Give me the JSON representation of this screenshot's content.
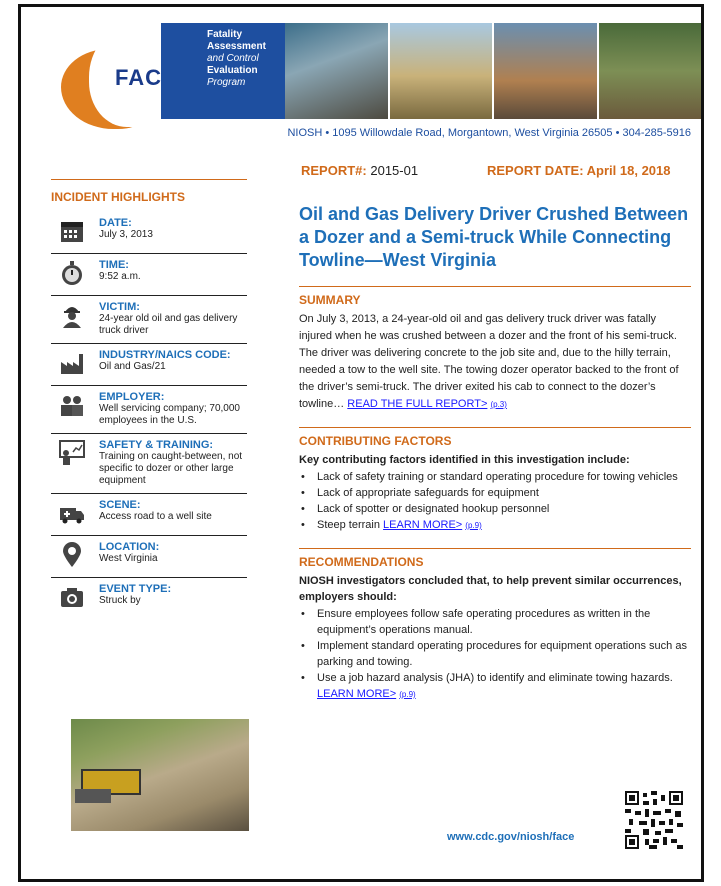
{
  "header": {
    "face_logo": "FACE",
    "program_lines": [
      "Fatality",
      "Assessment",
      "and Control",
      "Evaluation",
      "Program"
    ],
    "address": "NIOSH • 1095 Willowdale Road, Morgantown, West Virginia  26505 • 304-285-5916"
  },
  "report": {
    "number_label": "REPORT#:",
    "number": "2015-01",
    "date": "REPORT DATE: April 18, 2018"
  },
  "title": "Oil and Gas Delivery Driver Crushed Between a Dozer and a Semi-truck While Connecting Towline—West Virginia",
  "sidebar": {
    "heading": "INCIDENT HIGHLIGHTS",
    "items": [
      {
        "label": "DATE:",
        "value": "July 3, 2013",
        "icon": "calendar-icon"
      },
      {
        "label": "TIME:",
        "value": "9:52 a.m.",
        "icon": "stopwatch-icon"
      },
      {
        "label": "VICTIM:",
        "value": "24-year old oil and gas delivery truck driver",
        "icon": "worker-icon"
      },
      {
        "label": "INDUSTRY/NAICS CODE:",
        "value": "Oil and Gas/21",
        "icon": "factory-icon"
      },
      {
        "label": "EMPLOYER:",
        "value": "Well servicing company; 70,000 employees in the U.S.",
        "icon": "people-icon"
      },
      {
        "label": "SAFETY & TRAINING:",
        "value": "Training on caught-between, not specific to dozer or other large equipment",
        "icon": "trainer-icon"
      },
      {
        "label": "SCENE:",
        "value": "Access road to a well site",
        "icon": "ambulance-icon"
      },
      {
        "label": "LOCATION:",
        "value": "West Virginia",
        "icon": "location-pin-icon"
      },
      {
        "label": "EVENT TYPE:",
        "value": "Struck by",
        "icon": "camera-icon"
      }
    ]
  },
  "summary": {
    "heading": "SUMMARY",
    "text": "On July 3, 2013, a 24-year-old oil and gas delivery truck driver was fatally injured when he was crushed between a dozer and the front of his semi-truck. The driver was delivering concrete to the job site and, due to the hilly terrain, needed a tow to the well site. The towing dozer operator backed to the front of the driver’s semi-truck. The driver exited his cab to connect to the dozer’s towline… ",
    "link": "READ THE FULL REPORT>",
    "page": "(p.3)"
  },
  "factors": {
    "heading": "CONTRIBUTING FACTORS",
    "lead": "Key contributing factors identified in this investigation include:",
    "items": [
      "Lack of safety training or standard operating procedure for towing vehicles",
      "Lack of appropriate safeguards for equipment",
      "Lack of spotter or designated hookup personnel",
      "Steep terrain "
    ],
    "link": "LEARN MORE>",
    "page": "(p.9)"
  },
  "recommendations": {
    "heading": "RECOMMENDATIONS",
    "lead": "NIOSH investigators concluded that, to help prevent similar occurrences, employers should:",
    "items": [
      "Ensure employees follow safe operating procedures as written in the equipment’s operations manual.",
      "Implement standard operating procedures for equipment operations such as parking and towing.",
      "Use a job hazard analysis (JHA) to identify and eliminate towing hazards. "
    ],
    "link": "LEARN MORE>",
    "page": "(p.9)"
  },
  "footer": {
    "url": "www.cdc.gov/niosh/face"
  },
  "colors": {
    "orange": "#d06a1a",
    "blue": "#1e6fb8",
    "navy": "#1e4fa0"
  }
}
